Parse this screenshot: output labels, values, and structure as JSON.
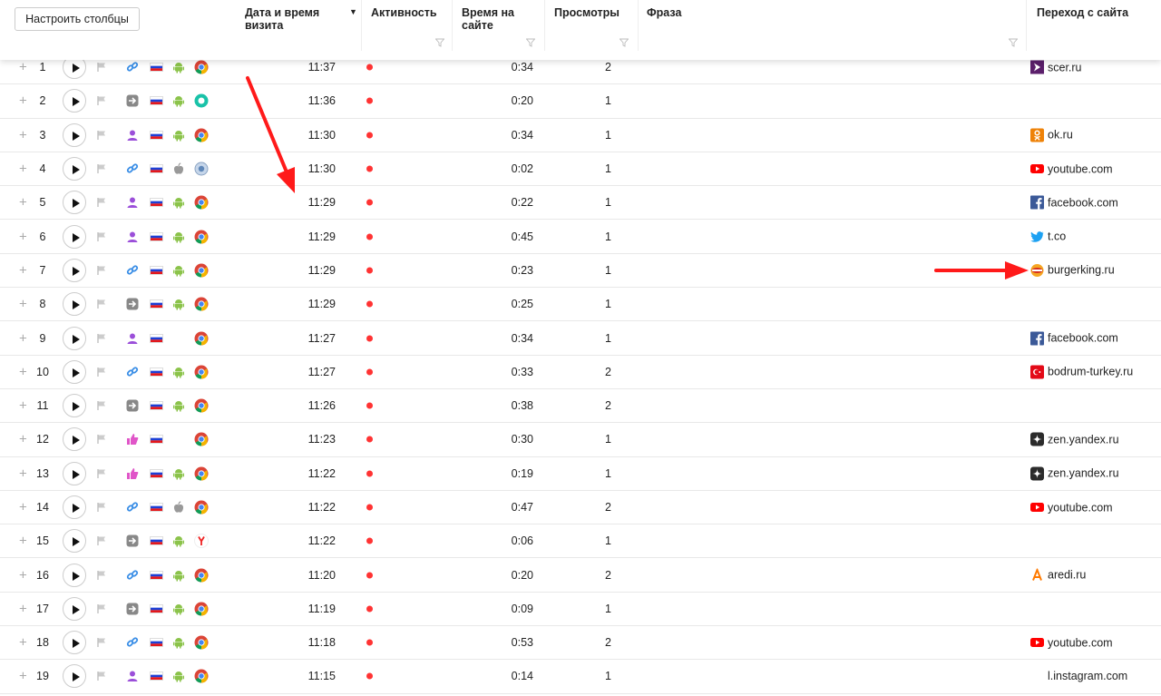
{
  "toolbar": {
    "configure_columns": "Настроить столбцы"
  },
  "columns": {
    "datetime": "Дата и время визита",
    "activity": "Активность",
    "time_on_site": "Время на сайте",
    "views": "Просмотры",
    "phrase": "Фраза",
    "referrer": "Переход с сайта"
  },
  "colors": {
    "activity_dot": "#ff3333",
    "annotation_arrow": "#ff1a1a"
  },
  "rows": [
    {
      "num": "1",
      "time": "11:37",
      "dur": "0:34",
      "views": "2",
      "src": "link-icon",
      "os": "android-icon",
      "browser": "chrome-icon",
      "ref": "scer.ru",
      "ref_icon": "scer-icon"
    },
    {
      "num": "2",
      "time": "11:36",
      "dur": "0:20",
      "views": "1",
      "src": "direct-icon",
      "os": "android-icon",
      "browser": "browser-green-icon",
      "ref": "",
      "ref_icon": ""
    },
    {
      "num": "3",
      "time": "11:30",
      "dur": "0:34",
      "views": "1",
      "src": "social-icon",
      "os": "android-icon",
      "browser": "chrome-icon",
      "ref": "ok.ru",
      "ref_icon": "ok-icon"
    },
    {
      "num": "4",
      "time": "11:30",
      "dur": "0:02",
      "views": "1",
      "src": "link-icon",
      "os": "apple-icon",
      "browser": "safari-icon",
      "ref": "youtube.com",
      "ref_icon": "youtube-icon"
    },
    {
      "num": "5",
      "time": "11:29",
      "dur": "0:22",
      "views": "1",
      "src": "social-icon",
      "os": "android-icon",
      "browser": "chrome-icon",
      "ref": "facebook.com",
      "ref_icon": "facebook-icon"
    },
    {
      "num": "6",
      "time": "11:29",
      "dur": "0:45",
      "views": "1",
      "src": "social-icon",
      "os": "android-icon",
      "browser": "chrome-icon",
      "ref": "t.co",
      "ref_icon": "twitter-icon"
    },
    {
      "num": "7",
      "time": "11:29",
      "dur": "0:23",
      "views": "1",
      "src": "link-icon",
      "os": "android-icon",
      "browser": "chrome-icon",
      "ref": "burgerking.ru",
      "ref_icon": "burgerking-icon"
    },
    {
      "num": "8",
      "time": "11:29",
      "dur": "0:25",
      "views": "1",
      "src": "direct-icon",
      "os": "android-icon",
      "browser": "chrome-icon",
      "ref": "",
      "ref_icon": ""
    },
    {
      "num": "9",
      "time": "11:27",
      "dur": "0:34",
      "views": "1",
      "src": "social-icon",
      "os": "",
      "browser": "chrome-icon",
      "ref": "facebook.com",
      "ref_icon": "facebook-icon"
    },
    {
      "num": "10",
      "time": "11:27",
      "dur": "0:33",
      "views": "2",
      "src": "link-icon",
      "os": "android-icon",
      "browser": "chrome-icon",
      "ref": "bodrum-turkey.ru",
      "ref_icon": "turkey-flag-icon"
    },
    {
      "num": "11",
      "time": "11:26",
      "dur": "0:38",
      "views": "2",
      "src": "direct-icon",
      "os": "android-icon",
      "browser": "chrome-icon",
      "ref": "",
      "ref_icon": ""
    },
    {
      "num": "12",
      "time": "11:23",
      "dur": "0:30",
      "views": "1",
      "src": "ad-icon",
      "os": "",
      "browser": "chrome-icon",
      "ref": "zen.yandex.ru",
      "ref_icon": "zen-icon"
    },
    {
      "num": "13",
      "time": "11:22",
      "dur": "0:19",
      "views": "1",
      "src": "ad-icon",
      "os": "android-icon",
      "browser": "chrome-icon",
      "ref": "zen.yandex.ru",
      "ref_icon": "zen-icon"
    },
    {
      "num": "14",
      "time": "11:22",
      "dur": "0:47",
      "views": "2",
      "src": "link-icon",
      "os": "apple-icon",
      "browser": "chrome-icon",
      "ref": "youtube.com",
      "ref_icon": "youtube-icon"
    },
    {
      "num": "15",
      "time": "11:22",
      "dur": "0:06",
      "views": "1",
      "src": "direct-icon",
      "os": "android-icon",
      "browser": "yandex-browser-icon",
      "ref": "",
      "ref_icon": ""
    },
    {
      "num": "16",
      "time": "11:20",
      "dur": "0:20",
      "views": "2",
      "src": "link-icon",
      "os": "android-icon",
      "browser": "chrome-icon",
      "ref": "aredi.ru",
      "ref_icon": "aredi-icon"
    },
    {
      "num": "17",
      "time": "11:19",
      "dur": "0:09",
      "views": "1",
      "src": "direct-icon",
      "os": "android-icon",
      "browser": "chrome-icon",
      "ref": "",
      "ref_icon": ""
    },
    {
      "num": "18",
      "time": "11:18",
      "dur": "0:53",
      "views": "2",
      "src": "link-icon",
      "os": "android-icon",
      "browser": "chrome-icon",
      "ref": "youtube.com",
      "ref_icon": "youtube-icon"
    },
    {
      "num": "19",
      "time": "11:15",
      "dur": "0:14",
      "views": "1",
      "src": "social-icon",
      "os": "android-icon",
      "browser": "chrome-icon",
      "ref": "l.instagram.com",
      "ref_icon": ""
    }
  ]
}
